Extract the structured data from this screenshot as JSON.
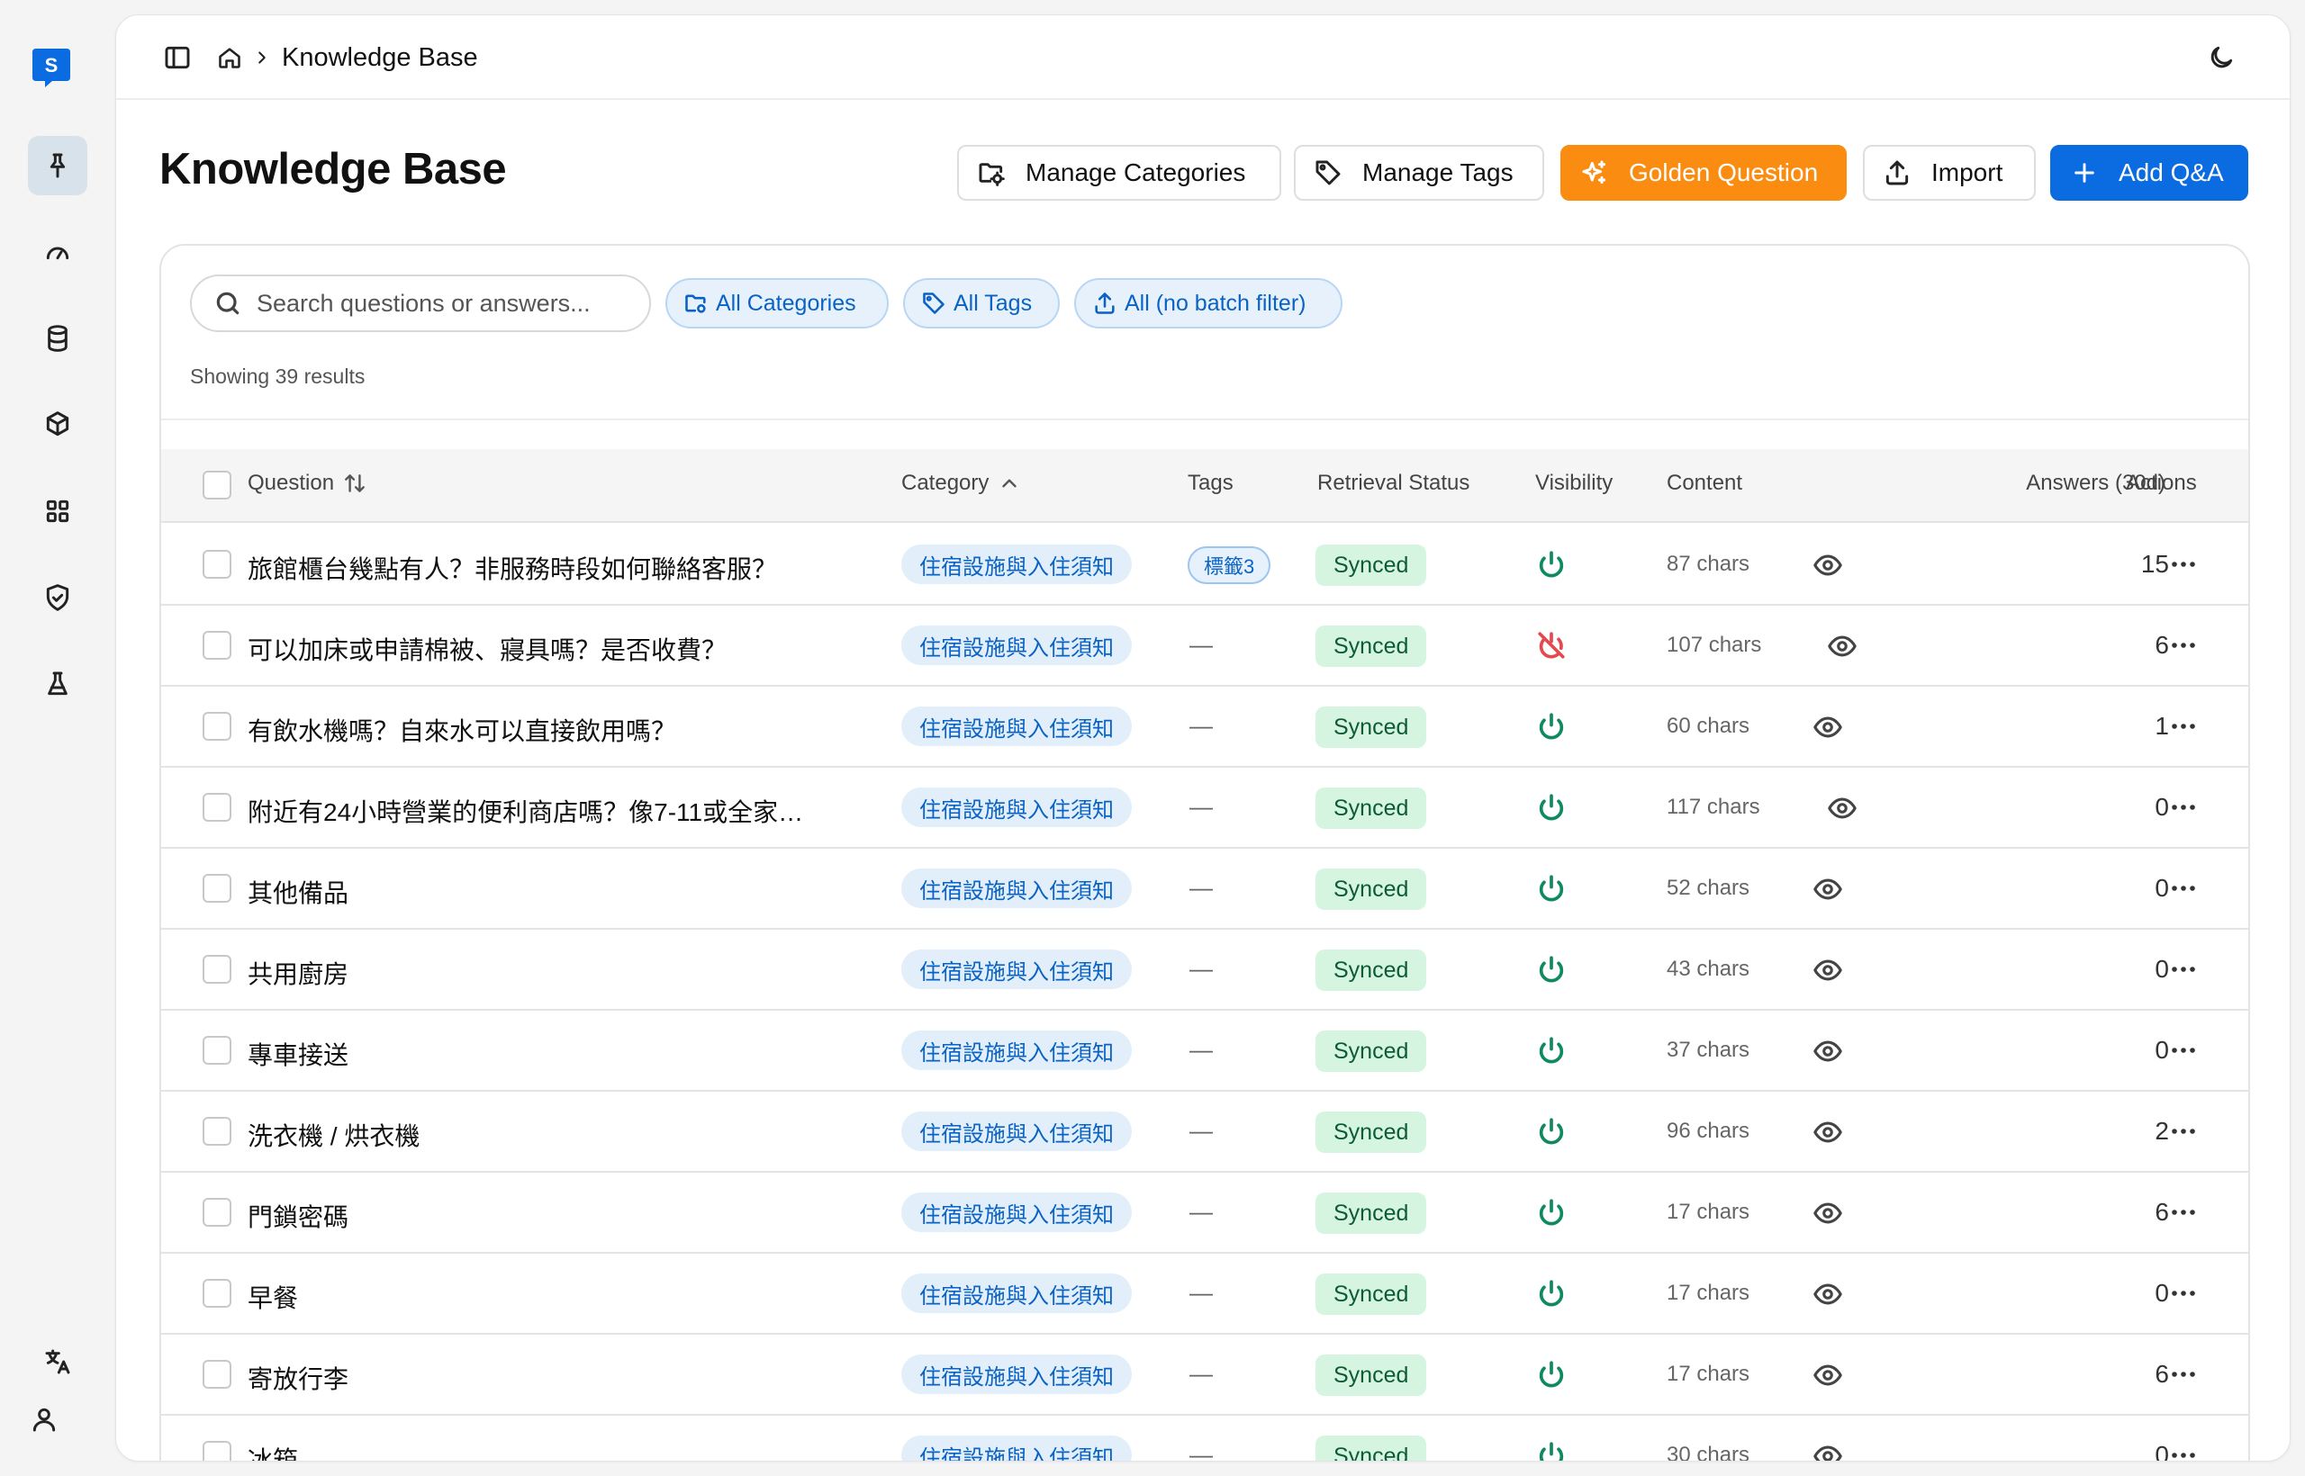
{
  "app": {
    "logo_letter": "S"
  },
  "nav": {
    "items": [
      {
        "icon": "pin-icon",
        "active": true
      },
      {
        "icon": "gauge-icon",
        "active": false
      },
      {
        "icon": "database-icon",
        "active": false
      },
      {
        "icon": "package-icon",
        "active": false
      },
      {
        "icon": "grid-icon",
        "active": false
      },
      {
        "icon": "shield-check-icon",
        "active": false
      },
      {
        "icon": "flask-icon",
        "active": false
      }
    ],
    "bottom": [
      {
        "icon": "language-icon"
      },
      {
        "icon": "user-icon"
      }
    ]
  },
  "breadcrumb": {
    "current": "Knowledge Base"
  },
  "page": {
    "title": "Knowledge Base"
  },
  "toolbar": {
    "manage_categories": "Manage Categories",
    "manage_tags": "Manage Tags",
    "golden_question": "Golden Question",
    "import": "Import",
    "add_qa": "Add Q&A"
  },
  "filters": {
    "search_placeholder": "Search questions or answers...",
    "categories": "All Categories",
    "tags": "All Tags",
    "batch": "All (no batch filter)",
    "result_count": "Showing 39 results"
  },
  "table": {
    "headers": {
      "question": "Question",
      "category": "Category",
      "tags": "Tags",
      "retrieval_status": "Retrieval Status",
      "visibility": "Visibility",
      "content": "Content",
      "answers": "Answers (30d)",
      "actions": "Actions"
    },
    "rows": [
      {
        "question": "旅館櫃台幾點有人？非服務時段如何聯絡客服？",
        "category": "住宿設施與入住須知",
        "tag": "標籤3",
        "status": "Synced",
        "visible": true,
        "chars": "87 chars",
        "answers": "15"
      },
      {
        "question": "可以加床或申請棉被、寢具嗎？是否收費？",
        "category": "住宿設施與入住須知",
        "tag": "—",
        "status": "Synced",
        "visible": false,
        "chars": "107 chars",
        "answers": "6"
      },
      {
        "question": "有飲水機嗎？自來水可以直接飲用嗎？",
        "category": "住宿設施與入住須知",
        "tag": "—",
        "status": "Synced",
        "visible": true,
        "chars": "60 chars",
        "answers": "1"
      },
      {
        "question": "附近有24小時營業的便利商店嗎？像7-11或全家便...",
        "category": "住宿設施與入住須知",
        "tag": "—",
        "status": "Synced",
        "visible": true,
        "chars": "117 chars",
        "answers": "0"
      },
      {
        "question": "其他備品",
        "category": "住宿設施與入住須知",
        "tag": "—",
        "status": "Synced",
        "visible": true,
        "chars": "52 chars",
        "answers": "0"
      },
      {
        "question": "共用廚房",
        "category": "住宿設施與入住須知",
        "tag": "—",
        "status": "Synced",
        "visible": true,
        "chars": "43 chars",
        "answers": "0"
      },
      {
        "question": "專車接送",
        "category": "住宿設施與入住須知",
        "tag": "—",
        "status": "Synced",
        "visible": true,
        "chars": "37 chars",
        "answers": "0"
      },
      {
        "question": "洗衣機 / 烘衣機",
        "category": "住宿設施與入住須知",
        "tag": "—",
        "status": "Synced",
        "visible": true,
        "chars": "96 chars",
        "answers": "2"
      },
      {
        "question": "門鎖密碼",
        "category": "住宿設施與入住須知",
        "tag": "—",
        "status": "Synced",
        "visible": true,
        "chars": "17 chars",
        "answers": "6"
      },
      {
        "question": "早餐",
        "category": "住宿設施與入住須知",
        "tag": "—",
        "status": "Synced",
        "visible": true,
        "chars": "17 chars",
        "answers": "0"
      },
      {
        "question": "寄放行李",
        "category": "住宿設施與入住須知",
        "tag": "—",
        "status": "Synced",
        "visible": true,
        "chars": "17 chars",
        "answers": "6"
      },
      {
        "question": "冰箱",
        "category": "住宿設施與入住須知",
        "tag": "—",
        "status": "Synced",
        "visible": true,
        "chars": "30 chars",
        "answers": "0"
      }
    ]
  },
  "colors": {
    "primary": "#0a6ce0",
    "golden": "#fb8c12",
    "synced_bg": "#d6f5e1",
    "visible_on": "#0f8a5f",
    "visible_off": "#e5484d"
  }
}
